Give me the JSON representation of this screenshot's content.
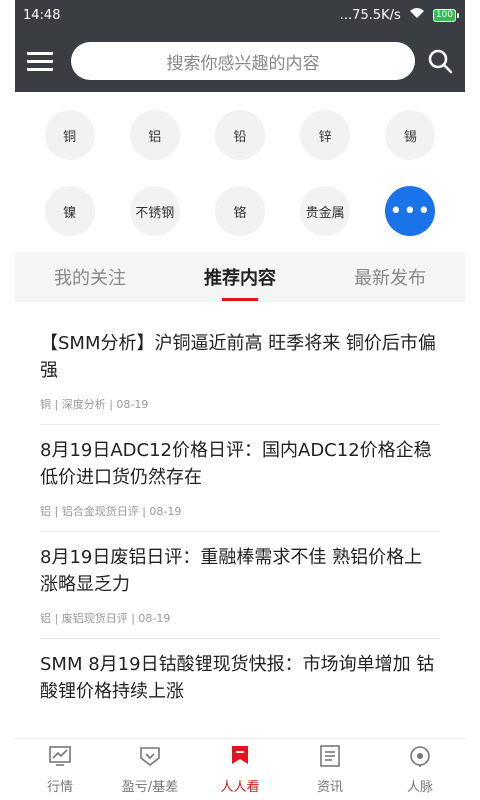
{
  "status": {
    "time": "14:48",
    "network_speed": "...75.5K/s",
    "battery": "100"
  },
  "header": {
    "search_placeholder": "搜索你感兴趣的内容"
  },
  "categories": [
    [
      "铜",
      "铝",
      "铅",
      "锌",
      "锡"
    ],
    [
      "镍",
      "不锈钢",
      "铬",
      "贵金属"
    ]
  ],
  "more_label": "•••",
  "tabs": [
    "我的关注",
    "推荐内容",
    "最新发布"
  ],
  "articles": [
    {
      "title": "【SMM分析】沪铜逼近前高 旺季将来 铜价后市偏强",
      "meta": "铜 | 深度分析 | 08-19"
    },
    {
      "title": "8月19日ADC12价格日评：国内ADC12价格企稳 低价进口货仍然存在",
      "meta": "铝 | 铝合金现货日评 | 08-19"
    },
    {
      "title": "8月19日废铝日评：重融棒需求不佳 熟铝价格上涨略显乏力",
      "meta": "铝 | 废铝现货日评 | 08-19"
    },
    {
      "title": "SMM 8月19日钴酸锂现货快报：市场询单增加 钴酸锂价格持续上涨",
      "meta": ""
    }
  ],
  "nav": [
    "行情",
    "盈亏/基差",
    "人人看",
    "资讯",
    "人脉"
  ],
  "colors": {
    "accent": "#e0161c",
    "header_bg": "#3a3d42",
    "more_button": "#1a73e8"
  }
}
